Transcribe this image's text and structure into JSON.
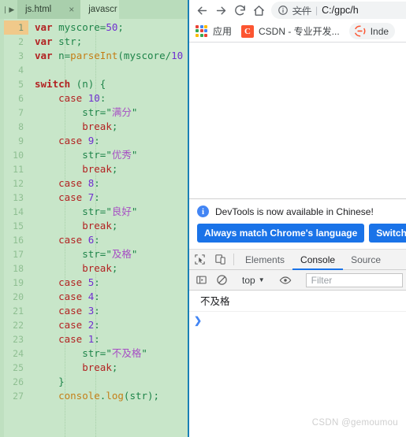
{
  "editor": {
    "tabs": [
      {
        "label": "js.html",
        "active": true,
        "close_icon": "close-icon"
      },
      {
        "label": "javascr",
        "active": false
      }
    ],
    "nav_prev_icon": "◀",
    "nav_next_icon": "▶",
    "close_glyph": "×",
    "active_line": 1,
    "lines": [
      {
        "n": "1",
        "tokens": [
          {
            "t": "var",
            "c": "kw"
          },
          {
            "t": " ",
            "c": "pun"
          },
          {
            "t": "myscore",
            "c": "id"
          },
          {
            "t": "=",
            "c": "pun"
          },
          {
            "t": "50",
            "c": "num"
          },
          {
            "t": ";",
            "c": "pun"
          }
        ]
      },
      {
        "n": "2",
        "tokens": [
          {
            "t": "var",
            "c": "kw"
          },
          {
            "t": " ",
            "c": "pun"
          },
          {
            "t": "str",
            "c": "id"
          },
          {
            "t": ";",
            "c": "pun"
          }
        ]
      },
      {
        "n": "3",
        "tokens": [
          {
            "t": "var",
            "c": "kw"
          },
          {
            "t": " ",
            "c": "pun"
          },
          {
            "t": "n",
            "c": "id"
          },
          {
            "t": "=",
            "c": "pun"
          },
          {
            "t": "parseInt",
            "c": "fn"
          },
          {
            "t": "(",
            "c": "pun"
          },
          {
            "t": "myscore",
            "c": "id"
          },
          {
            "t": "/",
            "c": "pun"
          },
          {
            "t": "10",
            "c": "num"
          }
        ]
      },
      {
        "n": "4",
        "tokens": []
      },
      {
        "n": "5",
        "tokens": [
          {
            "t": "switch",
            "c": "kw"
          },
          {
            "t": " (",
            "c": "pun"
          },
          {
            "t": "n",
            "c": "id"
          },
          {
            "t": ") {",
            "c": "pun"
          }
        ]
      },
      {
        "n": "6",
        "tokens": [
          {
            "t": "    ",
            "c": "pun"
          },
          {
            "t": "case",
            "c": "kw2"
          },
          {
            "t": " ",
            "c": "pun"
          },
          {
            "t": "10",
            "c": "num"
          },
          {
            "t": ":",
            "c": "pun"
          }
        ]
      },
      {
        "n": "7",
        "tokens": [
          {
            "t": "        ",
            "c": "pun"
          },
          {
            "t": "str",
            "c": "id"
          },
          {
            "t": "=",
            "c": "pun"
          },
          {
            "t": "\"",
            "c": "strq"
          },
          {
            "t": "满分",
            "c": "str"
          },
          {
            "t": "\"",
            "c": "strq"
          }
        ]
      },
      {
        "n": "8",
        "tokens": [
          {
            "t": "        ",
            "c": "pun"
          },
          {
            "t": "break",
            "c": "kw2"
          },
          {
            "t": ";",
            "c": "pun"
          }
        ]
      },
      {
        "n": "9",
        "tokens": [
          {
            "t": "    ",
            "c": "pun"
          },
          {
            "t": "case",
            "c": "kw2"
          },
          {
            "t": " ",
            "c": "pun"
          },
          {
            "t": "9",
            "c": "num"
          },
          {
            "t": ":",
            "c": "pun"
          }
        ]
      },
      {
        "n": "10",
        "tokens": [
          {
            "t": "        ",
            "c": "pun"
          },
          {
            "t": "str",
            "c": "id"
          },
          {
            "t": "=",
            "c": "pun"
          },
          {
            "t": "\"",
            "c": "strq"
          },
          {
            "t": "优秀",
            "c": "str"
          },
          {
            "t": "\"",
            "c": "strq"
          }
        ]
      },
      {
        "n": "11",
        "tokens": [
          {
            "t": "        ",
            "c": "pun"
          },
          {
            "t": "break",
            "c": "kw2"
          },
          {
            "t": ";",
            "c": "pun"
          }
        ]
      },
      {
        "n": "12",
        "tokens": [
          {
            "t": "    ",
            "c": "pun"
          },
          {
            "t": "case",
            "c": "kw2"
          },
          {
            "t": " ",
            "c": "pun"
          },
          {
            "t": "8",
            "c": "num"
          },
          {
            "t": ":",
            "c": "pun"
          }
        ]
      },
      {
        "n": "13",
        "tokens": [
          {
            "t": "    ",
            "c": "pun"
          },
          {
            "t": "case",
            "c": "kw2"
          },
          {
            "t": " ",
            "c": "pun"
          },
          {
            "t": "7",
            "c": "num"
          },
          {
            "t": ":",
            "c": "pun"
          }
        ]
      },
      {
        "n": "14",
        "tokens": [
          {
            "t": "        ",
            "c": "pun"
          },
          {
            "t": "str",
            "c": "id"
          },
          {
            "t": "=",
            "c": "pun"
          },
          {
            "t": "\"",
            "c": "strq"
          },
          {
            "t": "良好",
            "c": "str"
          },
          {
            "t": "\"",
            "c": "strq"
          }
        ]
      },
      {
        "n": "15",
        "tokens": [
          {
            "t": "        ",
            "c": "pun"
          },
          {
            "t": "break",
            "c": "kw2"
          },
          {
            "t": ";",
            "c": "pun"
          }
        ]
      },
      {
        "n": "16",
        "tokens": [
          {
            "t": "    ",
            "c": "pun"
          },
          {
            "t": "case",
            "c": "kw2"
          },
          {
            "t": " ",
            "c": "pun"
          },
          {
            "t": "6",
            "c": "num"
          },
          {
            "t": ":",
            "c": "pun"
          }
        ]
      },
      {
        "n": "17",
        "tokens": [
          {
            "t": "        ",
            "c": "pun"
          },
          {
            "t": "str",
            "c": "id"
          },
          {
            "t": "=",
            "c": "pun"
          },
          {
            "t": "\"",
            "c": "strq"
          },
          {
            "t": "及格",
            "c": "str"
          },
          {
            "t": "\"",
            "c": "strq"
          }
        ]
      },
      {
        "n": "18",
        "tokens": [
          {
            "t": "        ",
            "c": "pun"
          },
          {
            "t": "break",
            "c": "kw2"
          },
          {
            "t": ";",
            "c": "pun"
          }
        ]
      },
      {
        "n": "19",
        "tokens": [
          {
            "t": "    ",
            "c": "pun"
          },
          {
            "t": "case",
            "c": "kw2"
          },
          {
            "t": " ",
            "c": "pun"
          },
          {
            "t": "5",
            "c": "num"
          },
          {
            "t": ":",
            "c": "pun"
          }
        ]
      },
      {
        "n": "20",
        "tokens": [
          {
            "t": "    ",
            "c": "pun"
          },
          {
            "t": "case",
            "c": "kw2"
          },
          {
            "t": " ",
            "c": "pun"
          },
          {
            "t": "4",
            "c": "num"
          },
          {
            "t": ":",
            "c": "pun"
          }
        ]
      },
      {
        "n": "21",
        "tokens": [
          {
            "t": "    ",
            "c": "pun"
          },
          {
            "t": "case",
            "c": "kw2"
          },
          {
            "t": " ",
            "c": "pun"
          },
          {
            "t": "3",
            "c": "num"
          },
          {
            "t": ":",
            "c": "pun"
          }
        ]
      },
      {
        "n": "22",
        "tokens": [
          {
            "t": "    ",
            "c": "pun"
          },
          {
            "t": "case",
            "c": "kw2"
          },
          {
            "t": " ",
            "c": "pun"
          },
          {
            "t": "2",
            "c": "num"
          },
          {
            "t": ":",
            "c": "pun"
          }
        ]
      },
      {
        "n": "23",
        "tokens": [
          {
            "t": "    ",
            "c": "pun"
          },
          {
            "t": "case",
            "c": "kw2"
          },
          {
            "t": " ",
            "c": "pun"
          },
          {
            "t": "1",
            "c": "num"
          },
          {
            "t": ":",
            "c": "pun"
          }
        ]
      },
      {
        "n": "24",
        "tokens": [
          {
            "t": "        ",
            "c": "pun"
          },
          {
            "t": "str",
            "c": "id"
          },
          {
            "t": "=",
            "c": "pun"
          },
          {
            "t": "\"",
            "c": "strq"
          },
          {
            "t": "不及格",
            "c": "str"
          },
          {
            "t": "\"",
            "c": "strq"
          }
        ]
      },
      {
        "n": "25",
        "tokens": [
          {
            "t": "        ",
            "c": "pun"
          },
          {
            "t": "break",
            "c": "kw2"
          },
          {
            "t": ";",
            "c": "pun"
          }
        ]
      },
      {
        "n": "26",
        "tokens": [
          {
            "t": "    ",
            "c": "pun"
          },
          {
            "t": "}",
            "c": "pun"
          }
        ]
      },
      {
        "n": "27",
        "tokens": [
          {
            "t": "    ",
            "c": "pun"
          },
          {
            "t": "console",
            "c": "obj"
          },
          {
            "t": ".",
            "c": "pun"
          },
          {
            "t": "log",
            "c": "obj"
          },
          {
            "t": "(",
            "c": "pun"
          },
          {
            "t": "str",
            "c": "id"
          },
          {
            "t": ");",
            "c": "pun"
          }
        ]
      }
    ]
  },
  "browser": {
    "nav": {
      "back_icon": "back-arrow-icon",
      "forward_icon": "forward-arrow-icon",
      "reload_icon": "reload-icon",
      "home_icon": "home-icon"
    },
    "omnibox": {
      "info_icon": "page-info-icon",
      "scheme_label": "文件",
      "separator": "|",
      "url": "C:/gpc/h"
    },
    "bookmarks": {
      "apps_label": "应用",
      "apps_icon": "apps-grid-icon",
      "items": [
        {
          "label": "CSDN - 专业开发...",
          "icon": "csdn-icon",
          "icon_text": "C"
        },
        {
          "label": "Inde",
          "icon": "idea-icon"
        }
      ]
    }
  },
  "devtools": {
    "notice": {
      "icon": "info-icon",
      "text": "DevTools is now available in Chinese!",
      "primary_button": "Always match Chrome's language",
      "secondary_button": "Switch D"
    },
    "toolbar": {
      "inspect_icon": "inspect-cursor-icon",
      "device_icon": "device-toolbar-icon",
      "tabs": [
        {
          "label": "Elements",
          "active": false
        },
        {
          "label": "Console",
          "active": true
        },
        {
          "label": "Source",
          "active": false
        }
      ]
    },
    "console_bar": {
      "sidebar_icon": "console-sidebar-icon",
      "clear_icon": "clear-console-icon",
      "context": "top",
      "context_caret": "▼",
      "eye_icon": "live-expression-icon",
      "filter_placeholder": "Filter"
    },
    "console": {
      "messages": [
        {
          "text": "不及格"
        }
      ],
      "prompt_glyph": "❯"
    }
  },
  "watermark": "CSDN @gemoumou"
}
